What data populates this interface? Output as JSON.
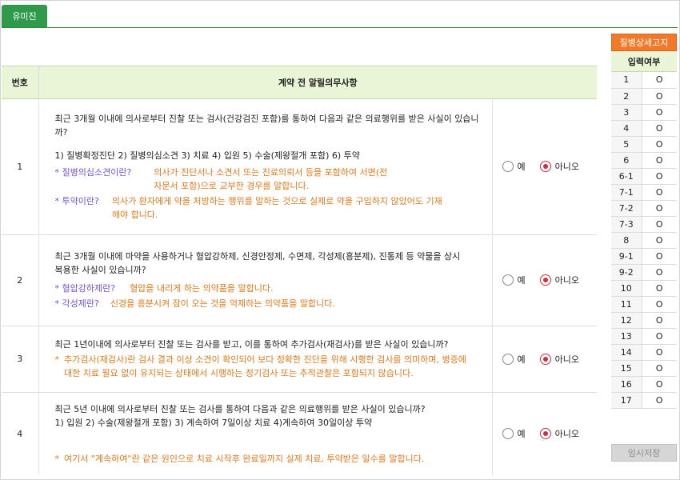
{
  "tab": {
    "label": "유미진"
  },
  "table": {
    "headers": {
      "num": "번호",
      "content": "계약 전 알릴의무사항"
    },
    "rows": [
      {
        "num": "1",
        "question": "최근 3개월 이내에 의사로부터 진찰 또는 검사(건강검진 포함)를 통하여 다음과 같은 의료행위를 받은 사실이 있습니까?",
        "options": "1) 질병확정진단   2) 질병의심소견   3) 치료   4) 입원   5) 수술(제왕절개 포함)   6) 투약",
        "notes": [
          {
            "term": "* 질병의심소견이란?",
            "desc": "의사가 진단서나 소견서 또는 진료의뢰서 등을 포함하여 서면(전자문서 포함)으로 교부한 경우를 말합니다."
          },
          {
            "term": "* 투약이란?",
            "desc": "의사가 환자에게 약을 처방하는 행위를 말하는 것으로 실제로 약을 구입하지 않았어도 기재해야 합니다."
          }
        ],
        "yes": "예",
        "no": "아니오",
        "selected": "no"
      },
      {
        "num": "2",
        "question": "최근 3개월 이내에 마약을 사용하거나 혈압강하제, 신경안정제, 수면제, 각성제(흥분제), 진통제 등 약물을 상시 복용한 사실이 있습니까?",
        "notes": [
          {
            "term": "* 혈압강하제란?",
            "desc": "혈압을 내리게 하는 의약품을 말합니다."
          },
          {
            "term": "* 각성제란?",
            "desc": "신경을 흥분시켜 잠이 오는 것을 억제하는 의약품을 말합니다."
          }
        ],
        "yes": "예",
        "no": "아니오",
        "selected": "no"
      },
      {
        "num": "3",
        "question": "최근 1년이내에 의사로부터 진찰 또는 검사를 받고, 이를 통하여 추가검사(재검사)를 받은 사실이 있습니까?",
        "note": "추가검사(재검사)란 검사 결과 이상 소견이 확인되어 보다 정확한 진단을 위해 시행한 검사를 의미하며, 병증에 대한 치료 필요 없이 유지되는 상태에서 시행하는 정기검사 또는 추적관찰은 포함되지 않습니다.",
        "yes": "예",
        "no": "아니오",
        "selected": "no"
      },
      {
        "num": "4",
        "question": "최근 5년 이내에 의사로부터 진찰 또는 검사를 통하여 다음과 같은 의료행위를 받은 사실이 있습니까?",
        "options": "1) 입원   2) 수술(제왕절개 포함)   3) 계속하여 7일이상 치료   4)계속하여 30일이상 투약",
        "note": "여기서 \"계속하여\"란 같은 원인으로 치료 시작후 완료일까지 실제 치료, 투약받은 일수를 말합니다.",
        "yes": "예",
        "no": "아니오",
        "selected": "no"
      }
    ]
  },
  "side": {
    "detail_button": "질병상세고지",
    "header": "입력여부",
    "rows": [
      {
        "n": "1",
        "v": "O"
      },
      {
        "n": "2",
        "v": "O"
      },
      {
        "n": "3",
        "v": "O"
      },
      {
        "n": "4",
        "v": "O"
      },
      {
        "n": "5",
        "v": "O"
      },
      {
        "n": "6",
        "v": "O"
      },
      {
        "n": "6-1",
        "v": "O"
      },
      {
        "n": "7-1",
        "v": "O"
      },
      {
        "n": "7-2",
        "v": "O"
      },
      {
        "n": "7-3",
        "v": "O"
      },
      {
        "n": "8",
        "v": "O"
      },
      {
        "n": "9-1",
        "v": "O"
      },
      {
        "n": "9-2",
        "v": "O"
      },
      {
        "n": "10",
        "v": "O"
      },
      {
        "n": "11",
        "v": "O"
      },
      {
        "n": "12",
        "v": "O"
      },
      {
        "n": "13",
        "v": "O"
      },
      {
        "n": "14",
        "v": "O"
      },
      {
        "n": "15",
        "v": "O"
      },
      {
        "n": "16",
        "v": "O"
      },
      {
        "n": "17",
        "v": "O"
      }
    ],
    "save_button": "임시저장"
  }
}
